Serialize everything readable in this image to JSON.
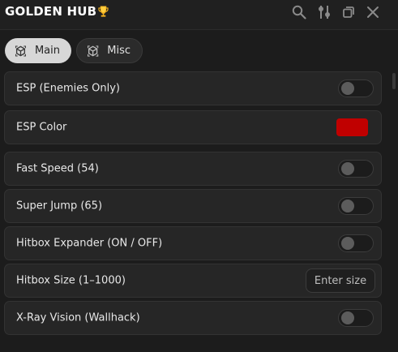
{
  "window": {
    "title": "GOLDEN HUB",
    "title_icon": "trophy-icon",
    "controls": [
      "search-icon",
      "settings-sliders-icon",
      "restore-icon",
      "close-icon"
    ]
  },
  "tabs": [
    {
      "label": "Main",
      "icon": "cube-icon",
      "active": true
    },
    {
      "label": "Misc",
      "icon": "cube-icon",
      "active": false
    }
  ],
  "rows": [
    {
      "label": "ESP (Enemies Only)",
      "control": "toggle",
      "value": false
    },
    {
      "label": "ESP Color",
      "control": "color",
      "color": "#c00000"
    },
    {
      "label": "Fast Speed (54)",
      "control": "toggle",
      "value": false
    },
    {
      "label": "Super Jump (65)",
      "control": "toggle",
      "value": false
    },
    {
      "label": "Hitbox Expander (ON / OFF)",
      "control": "toggle",
      "value": false
    },
    {
      "label": "Hitbox Size (1–1000)",
      "control": "textbox",
      "placeholder": "Enter size"
    },
    {
      "label": "X-Ray Vision (Wallhack)",
      "control": "toggle",
      "value": false
    }
  ],
  "colors": {
    "background": "#1c1c1c",
    "row": "#262626",
    "accent_active_tab": "#d7d7d7",
    "esp_color": "#c00000"
  }
}
